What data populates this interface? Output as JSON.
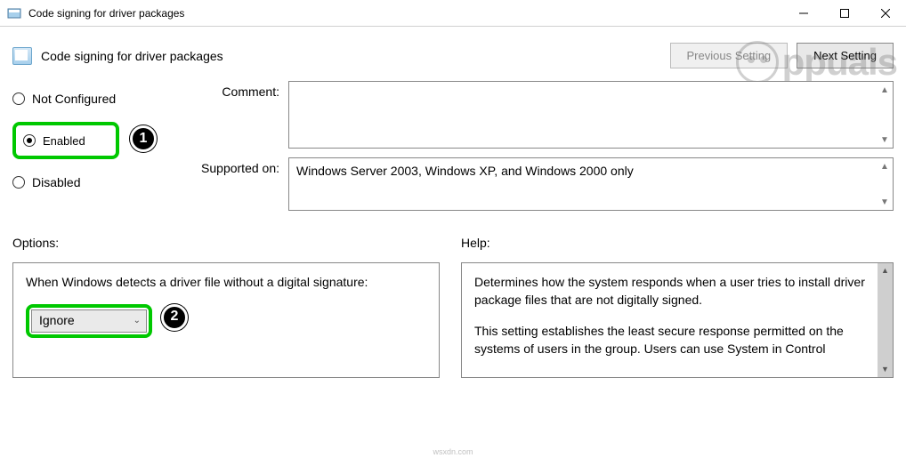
{
  "titlebar": {
    "title": "Code signing for driver packages"
  },
  "header": {
    "title": "Code signing for driver packages",
    "prev_btn": "Previous Setting",
    "next_btn": "Next Setting"
  },
  "radios": {
    "not_configured": "Not Configured",
    "enabled": "Enabled",
    "disabled": "Disabled"
  },
  "fields": {
    "comment_label": "Comment:",
    "comment_value": "",
    "supported_label": "Supported on:",
    "supported_value": "Windows Server 2003, Windows XP, and Windows 2000 only"
  },
  "bottom": {
    "options_label": "Options:",
    "help_label": "Help:",
    "options_text": "When Windows detects a driver file without a digital signature:",
    "dropdown_value": "Ignore",
    "help_text_1": "Determines how the system responds when a user tries to install driver package files that are not digitally signed.",
    "help_text_2": "This setting establishes the least secure response permitted on the systems of users in the group. Users can use System in Control"
  },
  "badges": {
    "one": "1",
    "two": "2"
  },
  "watermark": "ppuals"
}
